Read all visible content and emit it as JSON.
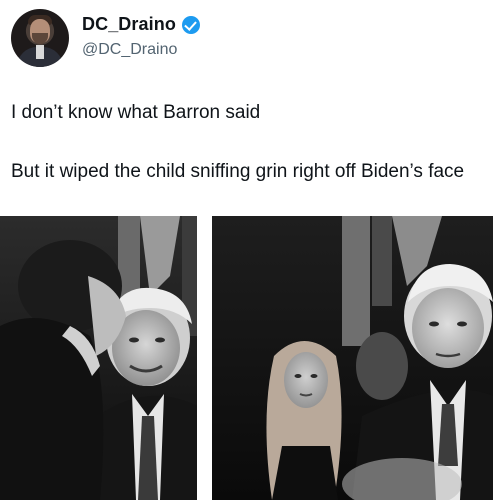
{
  "tweet": {
    "display_name": "DC_Draino",
    "handle": "@DC_Draino",
    "line1": "I don’t know what Barron said",
    "line2": "But it wiped the child sniffing grin right off Biden’s face"
  },
  "icons": {
    "verified": "verified-badge-icon",
    "avatar": "profile-avatar"
  },
  "colors": {
    "name": "#0f1419",
    "handle": "#536471",
    "verified": "#1d9bf0"
  }
}
